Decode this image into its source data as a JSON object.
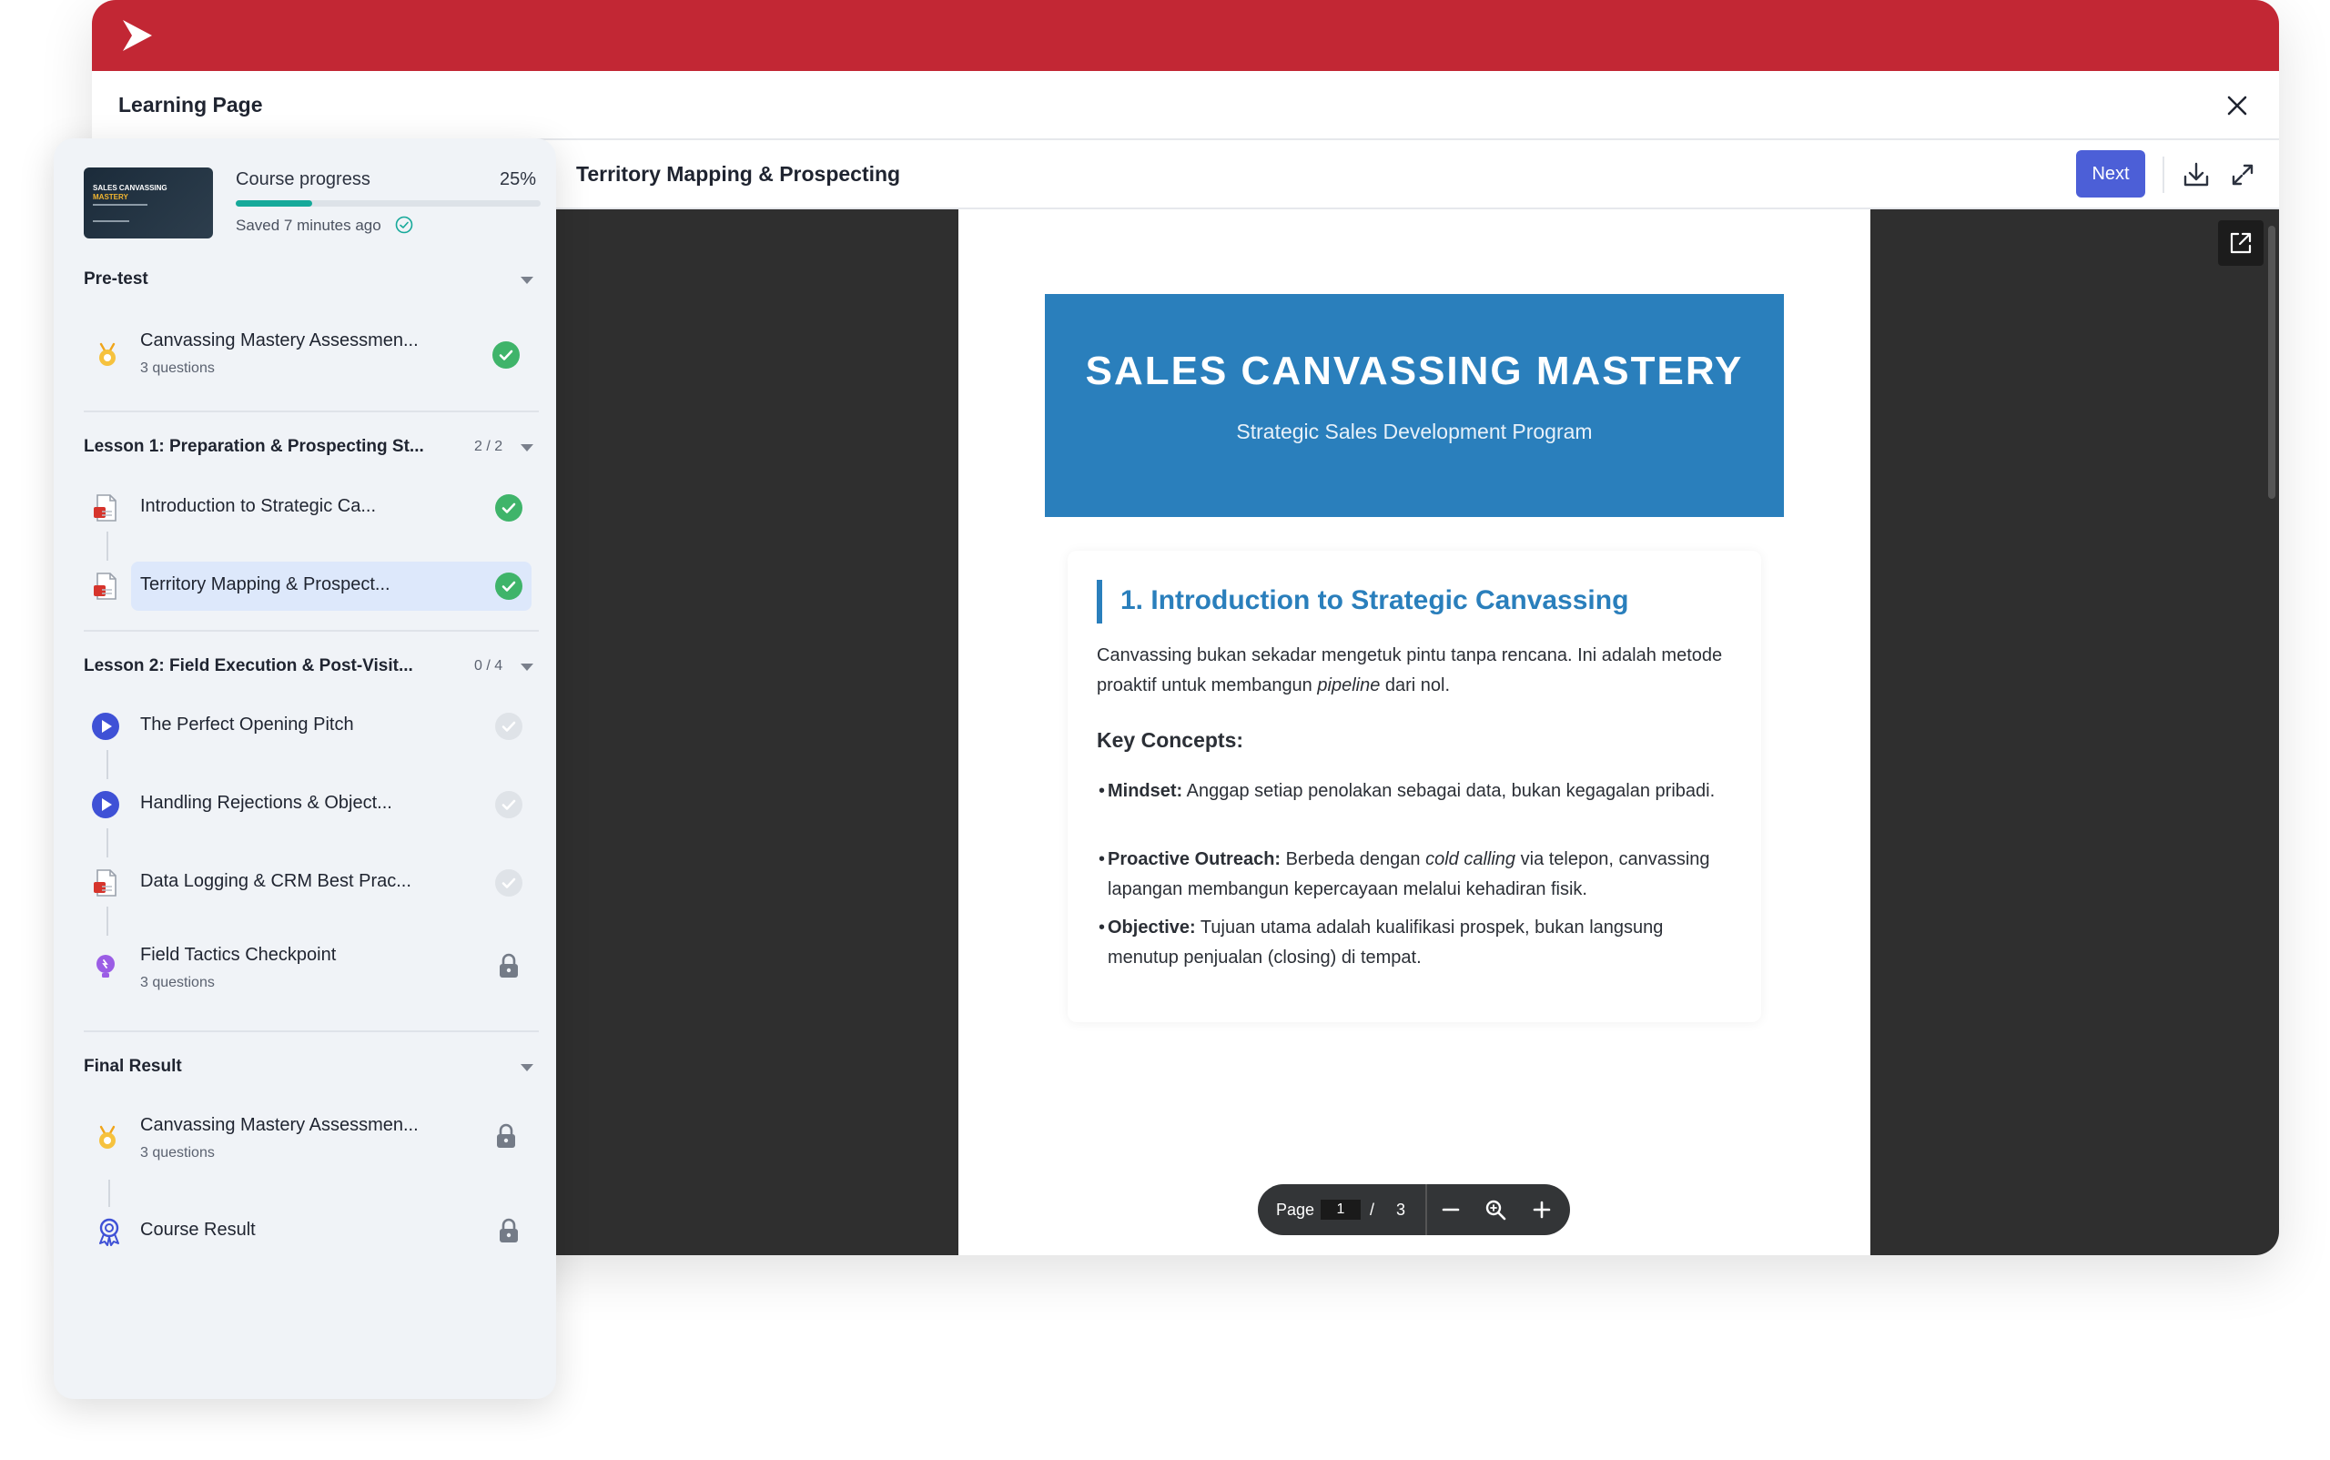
{
  "header": {
    "page_title": "Learning Page",
    "brand_color": "#c22734"
  },
  "document": {
    "title": "Territory Mapping & Prospecting",
    "next_label": "Next",
    "hero_title": "SALES CANVASSING MASTERY",
    "hero_subtitle": "Strategic Sales Development Program",
    "section_heading": "1. Introduction to Strategic Canvassing",
    "intro_pre": "Canvassing bukan sekadar mengetuk pintu tanpa rencana. Ini adalah metode proaktif untuk membangun ",
    "intro_em": "pipeline",
    "intro_post": " dari nol.",
    "key_heading": "Key Concepts:",
    "bullets": [
      {
        "term": "Mindset:",
        "pre": " Anggap setiap penolakan sebagai data, bukan kegagalan pribadi.",
        "em": "",
        "post": ""
      },
      {
        "term": "Proactive Outreach:",
        "pre": " Berbeda dengan ",
        "em": "cold calling",
        "post": " via telepon, canvassing lapangan membangun kepercayaan melalui kehadiran fisik."
      },
      {
        "term": "Objective:",
        "pre": " Tujuan utama adalah kualifikasi prospek, bukan langsung menutup penjualan (closing) di tempat.",
        "em": "",
        "post": ""
      }
    ]
  },
  "pager": {
    "label": "Page",
    "current": "1",
    "separator": "/",
    "total": "3"
  },
  "sidebar": {
    "thumb_line1": "SALES CANVASSING",
    "thumb_line2": "MASTERY",
    "progress_label": "Course progress",
    "progress_pct": "25%",
    "progress_value": 0.25,
    "saved_text": "Saved 7 minutes ago",
    "sections": [
      {
        "title": "Pre-test",
        "count": "",
        "items": [
          {
            "label": "Canvassing Mastery Assessmen...",
            "sub": "3 questions",
            "icon": "quiz-badge-icon",
            "status": "completed"
          }
        ]
      },
      {
        "title": "Lesson 1: Preparation & Prospecting St...",
        "count": "2 / 2",
        "items": [
          {
            "label": "Introduction to Strategic Ca...",
            "sub": "",
            "icon": "pdf-file-icon",
            "status": "completed"
          },
          {
            "label": "Territory Mapping & Prospect...",
            "sub": "",
            "icon": "pdf-file-icon",
            "status": "completed"
          }
        ]
      },
      {
        "title": "Lesson 2: Field Execution & Post-Visit...",
        "count": "0 / 4",
        "items": [
          {
            "label": "The Perfect Opening Pitch",
            "sub": "",
            "icon": "video-play-icon",
            "status": "incomplete"
          },
          {
            "label": "Handling Rejections & Object...",
            "sub": "",
            "icon": "video-play-icon",
            "status": "incomplete"
          },
          {
            "label": "Data Logging & CRM Best Prac...",
            "sub": "",
            "icon": "pdf-file-icon",
            "status": "incomplete"
          },
          {
            "label": "Field Tactics Checkpoint",
            "sub": "3 questions",
            "icon": "checkpoint-bulb-icon",
            "status": "locked"
          }
        ]
      },
      {
        "title": "Final Result",
        "count": "",
        "items": [
          {
            "label": "Canvassing Mastery Assessmen...",
            "sub": "3 questions",
            "icon": "quiz-badge-icon",
            "status": "locked"
          },
          {
            "label": "Course Result",
            "sub": "",
            "icon": "award-ribbon-icon",
            "status": "locked"
          }
        ]
      }
    ]
  },
  "colors": {
    "accent": "#4c5fd7",
    "progress": "#16a99a",
    "completed": "#3fb46a",
    "hero": "#2a7fbc"
  }
}
